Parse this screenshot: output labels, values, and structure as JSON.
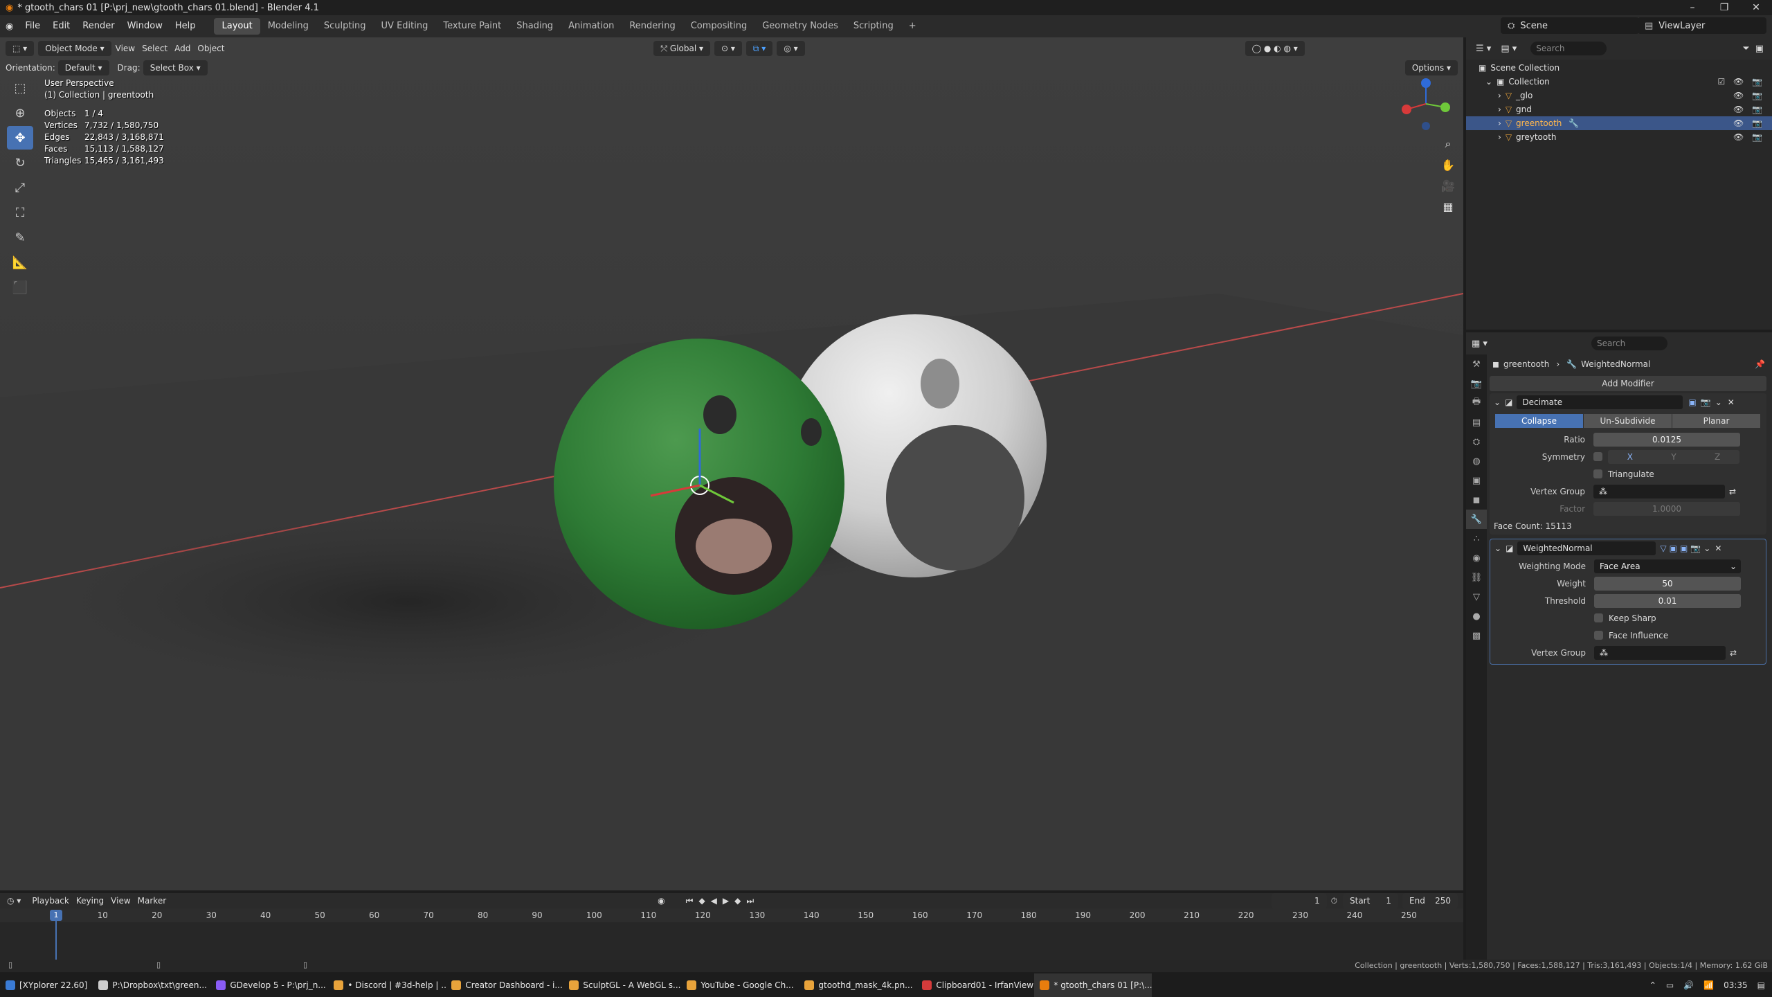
{
  "window": {
    "title": "* gtooth_chars 01 [P:\\prj_new\\gtooth_chars 01.blend] - Blender 4.1"
  },
  "menu": [
    "File",
    "Edit",
    "Render",
    "Window",
    "Help"
  ],
  "workspaces": [
    "Layout",
    "Modeling",
    "Sculpting",
    "UV Editing",
    "Texture Paint",
    "Shading",
    "Animation",
    "Rendering",
    "Compositing",
    "Geometry Nodes",
    "Scripting"
  ],
  "scene": {
    "name": "Scene",
    "view_layer": "ViewLayer"
  },
  "viewport_header": {
    "mode": "Object Mode",
    "menus": [
      "View",
      "Select",
      "Add",
      "Object"
    ],
    "transform": "Global",
    "options": "Options",
    "orientation_label": "Orientation:",
    "orientation_value": "Default",
    "drag_label": "Drag:",
    "drag_value": "Select Box"
  },
  "overlay": {
    "perspective": "User Perspective",
    "collection": "(1) Collection | greentooth",
    "stats": [
      {
        "k": "Objects",
        "v": "1 / 4"
      },
      {
        "k": "Vertices",
        "v": "7,732 / 1,580,750"
      },
      {
        "k": "Edges",
        "v": "22,843 / 3,168,871"
      },
      {
        "k": "Faces",
        "v": "15,113 / 1,588,127"
      },
      {
        "k": "Triangles",
        "v": "15,465 / 3,161,493"
      }
    ]
  },
  "outliner": {
    "search_placeholder": "Search",
    "root": "Scene Collection",
    "collection": "Collection",
    "items": [
      "_glo",
      "gnd",
      "greentooth",
      "greytooth"
    ],
    "selected": "greentooth"
  },
  "properties": {
    "search_placeholder": "Search",
    "breadcrumb_object": "greentooth",
    "breadcrumb_modifier": "WeightedNormal",
    "add_modifier": "Add Modifier",
    "decimate": {
      "name": "Decimate",
      "modes": [
        "Collapse",
        "Un-Subdivide",
        "Planar"
      ],
      "ratio_label": "Ratio",
      "ratio": "0.0125",
      "symmetry_label": "Symmetry",
      "axes": [
        "X",
        "Y",
        "Z"
      ],
      "triangulate": "Triangulate",
      "vertex_group_label": "Vertex Group",
      "factor_label": "Factor",
      "factor": "1.0000",
      "face_count": "Face Count: 15113"
    },
    "weighted_normal": {
      "name": "WeightedNormal",
      "weighting_mode_label": "Weighting Mode",
      "weighting_mode": "Face Area",
      "weight_label": "Weight",
      "weight": "50",
      "threshold_label": "Threshold",
      "threshold": "0.01",
      "keep_sharp": "Keep Sharp",
      "face_influence": "Face Influence",
      "vertex_group_label": "Vertex Group"
    }
  },
  "timeline": {
    "menus": [
      "Playback",
      "Keying",
      "View",
      "Marker"
    ],
    "current_frame": "1",
    "start_label": "Start",
    "start": "1",
    "end_label": "End",
    "end": "250",
    "ticks": [
      "1",
      "10",
      "20",
      "30",
      "40",
      "50",
      "60",
      "70",
      "80",
      "90",
      "100",
      "110",
      "120",
      "130",
      "140",
      "150",
      "160",
      "170",
      "180",
      "190",
      "200",
      "210",
      "220",
      "230",
      "240",
      "250"
    ]
  },
  "status": "Collection | greentooth | Verts:1,580,750 | Faces:1,588,127 | Tris:3,161,493 | Objects:1/4 | Memory: 1.62 GiB",
  "taskbar": {
    "items": [
      {
        "label": "[XYplorer 22.60]",
        "color": "#3a7bd5"
      },
      {
        "label": "P:\\Dropbox\\txt\\green...",
        "color": "#cccccc"
      },
      {
        "label": "GDevelop 5 - P:\\prj_n...",
        "color": "#8a5cf6"
      },
      {
        "label": "• Discord | #3d-help | ...",
        "color": "#e8a33b"
      },
      {
        "label": "Creator Dashboard - i...",
        "color": "#e8a33b"
      },
      {
        "label": "SculptGL - A WebGL s...",
        "color": "#e8a33b"
      },
      {
        "label": "YouTube - Google Ch...",
        "color": "#e8a33b"
      },
      {
        "label": "gtoothd_mask_4k.pn...",
        "color": "#e8a33b"
      },
      {
        "label": "Clipboard01 - IrfanView",
        "color": "#d63b3b"
      },
      {
        "label": "* gtooth_chars 01 [P:\\...",
        "color": "#e87d0d"
      }
    ],
    "clock": "03:35"
  }
}
